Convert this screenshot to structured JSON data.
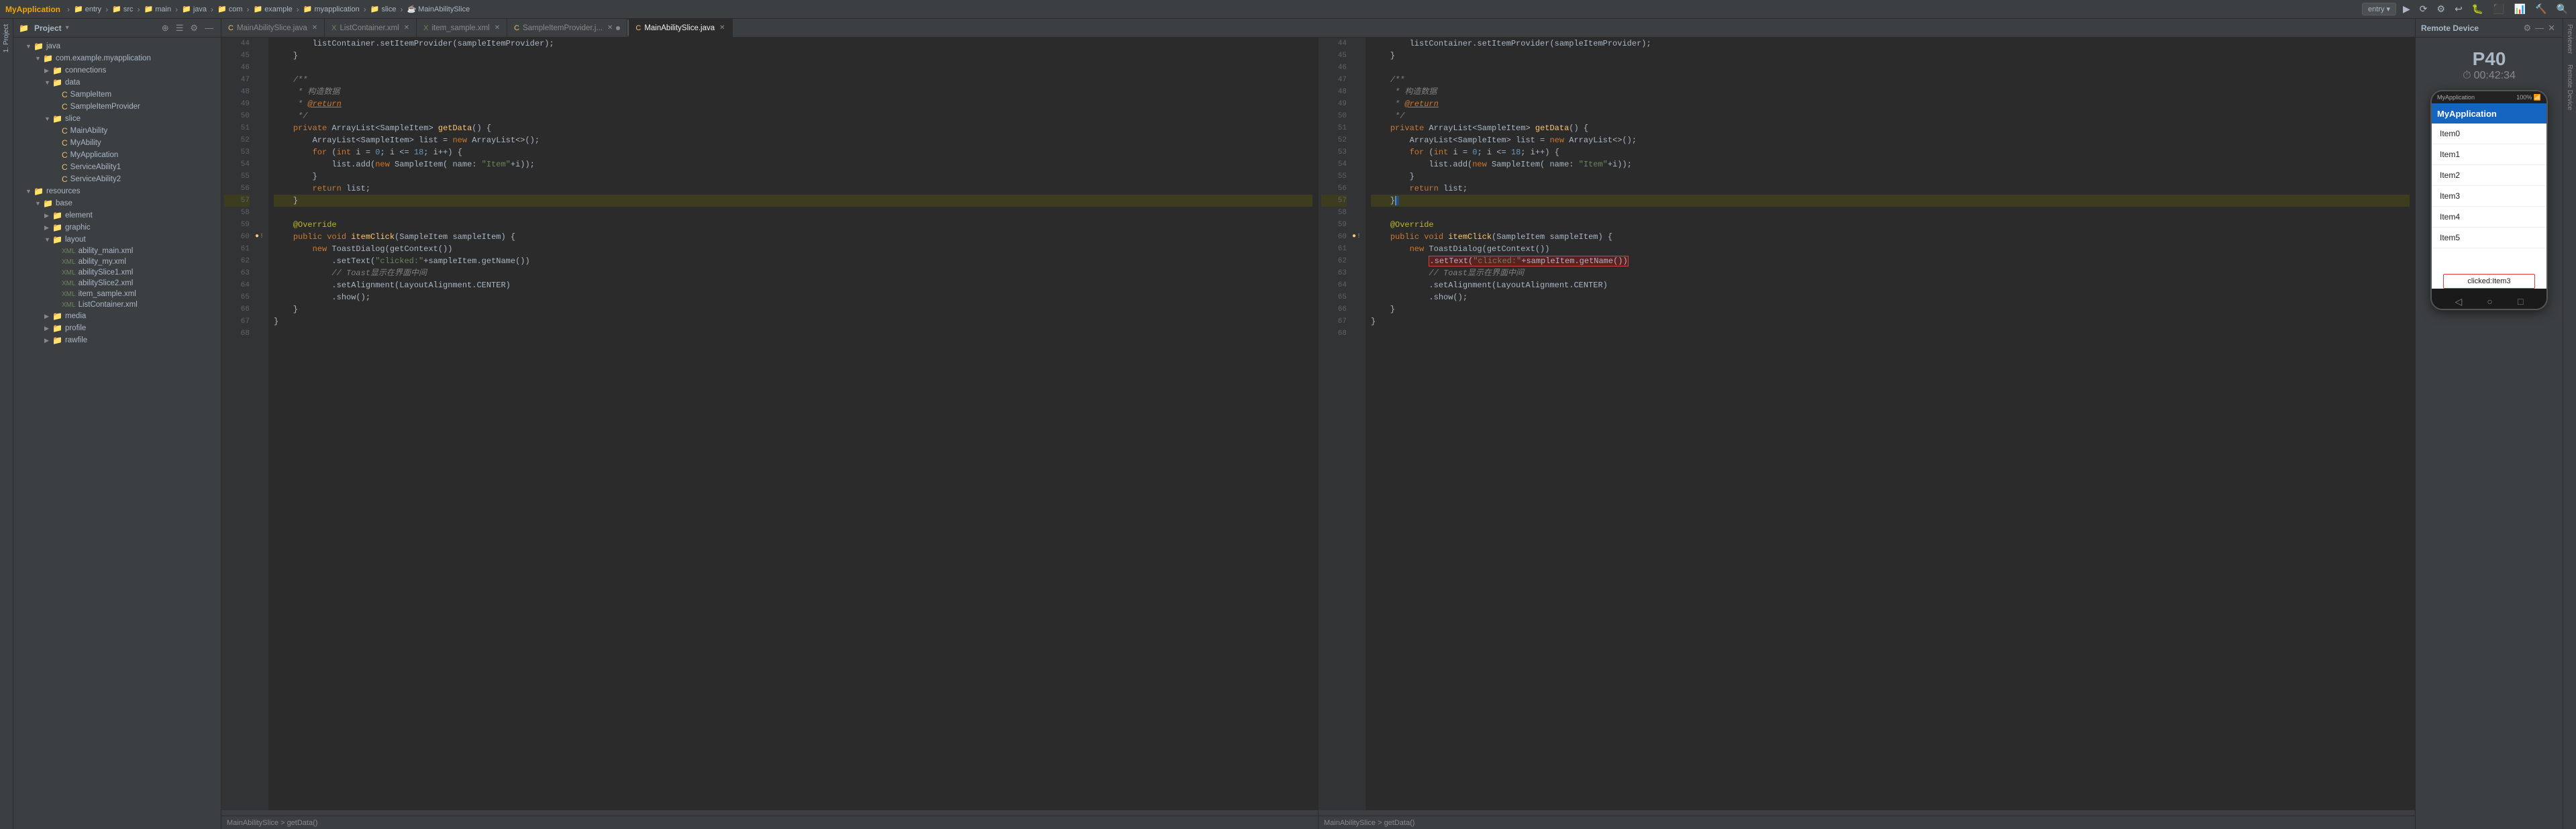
{
  "topbar": {
    "brand": "MyApplication",
    "breadcrumbs": [
      {
        "label": "entry",
        "type": "folder"
      },
      {
        "label": "src",
        "type": "folder"
      },
      {
        "label": "main",
        "type": "folder"
      },
      {
        "label": "java",
        "type": "folder"
      },
      {
        "label": "com",
        "type": "folder"
      },
      {
        "label": "example",
        "type": "folder"
      },
      {
        "label": "myapplication",
        "type": "folder"
      },
      {
        "label": "slice",
        "type": "folder"
      },
      {
        "label": "MainAbilitySlice",
        "type": "file"
      }
    ],
    "run_config": "entry",
    "buttons": [
      "run-config-dropdown",
      "refresh",
      "settings",
      "prev",
      "debug",
      "stop",
      "profile",
      "build",
      "search"
    ]
  },
  "project_panel": {
    "title": "Project",
    "tree": [
      {
        "level": 0,
        "label": "java",
        "type": "folder",
        "expanded": true
      },
      {
        "level": 1,
        "label": "com.example.myapplication",
        "type": "folder",
        "expanded": true
      },
      {
        "level": 2,
        "label": "connections",
        "type": "folder",
        "expanded": false
      },
      {
        "level": 2,
        "label": "data",
        "type": "folder",
        "expanded": true
      },
      {
        "level": 3,
        "label": "SampleItem",
        "type": "java"
      },
      {
        "level": 3,
        "label": "SampleItemProvider",
        "type": "java"
      },
      {
        "level": 2,
        "label": "slice",
        "type": "folder",
        "expanded": true
      },
      {
        "level": 3,
        "label": "MainAbility",
        "type": "java"
      },
      {
        "level": 3,
        "label": "MyAbility",
        "type": "java"
      },
      {
        "level": 3,
        "label": "MyApplication",
        "type": "java"
      },
      {
        "level": 3,
        "label": "ServiceAbility1",
        "type": "java"
      },
      {
        "level": 3,
        "label": "ServiceAbility2",
        "type": "java"
      },
      {
        "level": 0,
        "label": "resources",
        "type": "folder",
        "expanded": true
      },
      {
        "level": 1,
        "label": "base",
        "type": "folder",
        "expanded": true
      },
      {
        "level": 2,
        "label": "element",
        "type": "folder",
        "expanded": false
      },
      {
        "level": 2,
        "label": "graphic",
        "type": "folder",
        "expanded": false
      },
      {
        "level": 2,
        "label": "layout",
        "type": "folder",
        "expanded": true
      },
      {
        "level": 3,
        "label": "ability_main.xml",
        "type": "xml"
      },
      {
        "level": 3,
        "label": "ability_my.xml",
        "type": "xml"
      },
      {
        "level": 3,
        "label": "abilitySlice1.xml",
        "type": "xml"
      },
      {
        "level": 3,
        "label": "abilitySlice2.xml",
        "type": "xml"
      },
      {
        "level": 3,
        "label": "item_sample.xml",
        "type": "xml"
      },
      {
        "level": 3,
        "label": "ListContainer.xml",
        "type": "xml"
      },
      {
        "level": 2,
        "label": "media",
        "type": "folder",
        "expanded": false
      },
      {
        "level": 2,
        "label": "profile",
        "type": "folder",
        "expanded": false
      },
      {
        "level": 2,
        "label": "rawfile",
        "type": "folder",
        "expanded": false
      }
    ]
  },
  "editor_tabs": [
    {
      "label": "MainAbilitySlice.java",
      "type": "java",
      "active": false,
      "modified": false,
      "panel": "left"
    },
    {
      "label": "ListContainer.xml",
      "type": "xml",
      "active": false,
      "modified": false,
      "panel": "left"
    },
    {
      "label": "item_sample.xml",
      "type": "xml",
      "active": false,
      "modified": false,
      "panel": "left"
    },
    {
      "label": "SampleItemProvider.j...",
      "type": "java",
      "active": false,
      "modified": true,
      "panel": "left"
    },
    {
      "label": "MainAbilitySlice.java",
      "type": "java",
      "active": true,
      "modified": false,
      "panel": "right"
    }
  ],
  "code_left": {
    "footer": "MainAbilitySlice  >  getData()"
  },
  "code_right": {
    "footer": "MainAbilitySlice  >  getData()"
  },
  "remote_panel": {
    "title": "Remote Device",
    "device_name": "P40",
    "device_time": "00:42:34",
    "app_title": "MyApplication",
    "list_items": [
      "Item0",
      "Item1",
      "Item2",
      "Item3",
      "Item4",
      "Item5"
    ],
    "toast": "clicked:Item3"
  },
  "right_vtab": {
    "items": [
      "Previewer",
      "Remote Device"
    ]
  }
}
